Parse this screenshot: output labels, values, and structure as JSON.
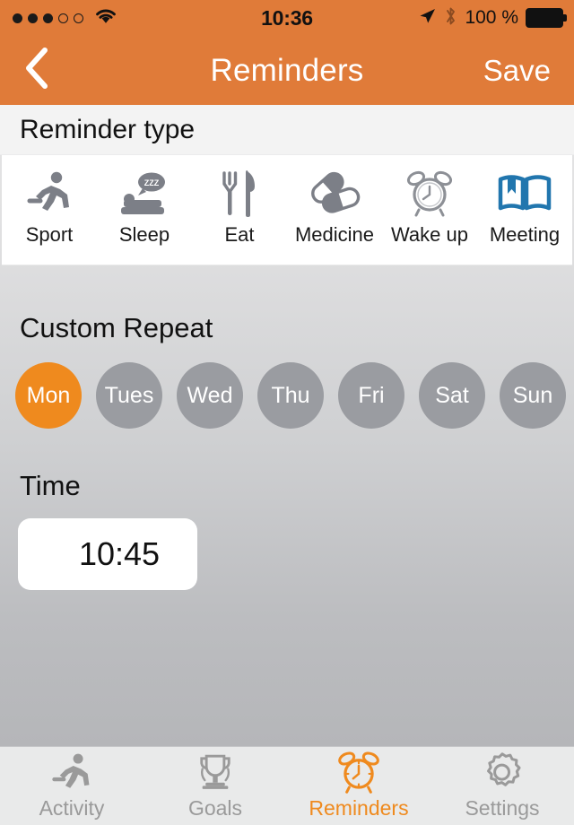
{
  "status_bar": {
    "signal_dots_filled": 3,
    "signal_dots_total": 5,
    "wifi_icon": "wifi-icon",
    "time": "10:36",
    "location_icon": "location-arrow-icon",
    "bluetooth_icon": "bluetooth-icon",
    "battery_percent": "100 %",
    "battery_icon": "battery-full-icon"
  },
  "navbar": {
    "back_icon": "chevron-left-icon",
    "title": "Reminders",
    "save_label": "Save"
  },
  "reminder_type": {
    "header": "Reminder type",
    "items": [
      {
        "label": "Sport",
        "icon": "running-person-icon",
        "selected": false
      },
      {
        "label": "Sleep",
        "icon": "bed-zzz-icon",
        "selected": false
      },
      {
        "label": "Eat",
        "icon": "fork-knife-icon",
        "selected": false
      },
      {
        "label": "Medicine",
        "icon": "pills-icon",
        "selected": false
      },
      {
        "label": "Wake up",
        "icon": "alarm-clock-icon",
        "selected": false
      },
      {
        "label": "Meeting",
        "icon": "open-book-icon",
        "selected": true
      }
    ]
  },
  "custom_repeat": {
    "title": "Custom Repeat",
    "days": [
      {
        "label": "Mon",
        "selected": true
      },
      {
        "label": "Tues",
        "selected": false
      },
      {
        "label": "Wed",
        "selected": false
      },
      {
        "label": "Thu",
        "selected": false
      },
      {
        "label": "Fri",
        "selected": false
      },
      {
        "label": "Sat",
        "selected": false
      },
      {
        "label": "Sun",
        "selected": false
      }
    ]
  },
  "time": {
    "title": "Time",
    "value": "10:45"
  },
  "tabbar": {
    "tabs": [
      {
        "label": "Activity",
        "icon": "running-person-icon",
        "active": false
      },
      {
        "label": "Goals",
        "icon": "trophy-icon",
        "active": false
      },
      {
        "label": "Reminders",
        "icon": "alarm-clock-icon",
        "active": true
      },
      {
        "label": "Settings",
        "icon": "gear-icon",
        "active": false
      }
    ]
  },
  "colors": {
    "header_orange": "#e07b39",
    "accent_orange": "#ef8a1e",
    "day_gray": "#9a9ca1",
    "icon_gray": "#7c7f87",
    "selected_blue": "#2176ae"
  }
}
